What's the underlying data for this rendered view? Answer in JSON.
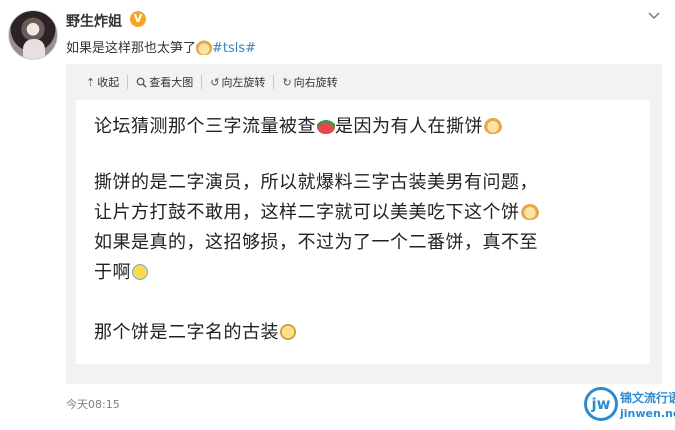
{
  "post": {
    "username": "野生炸姐",
    "verified_badge": "V",
    "text_prefix": "如果是这样那也太笋了",
    "hashtag": "#tsls#",
    "timestamp": "今天08:15"
  },
  "toolbar": {
    "collapse": "收起",
    "view_large": "查看大图",
    "rotate_left": "向左旋转",
    "rotate_right": "向右旋转"
  },
  "image_text": {
    "line1": "论坛猜测那个三字流量被查",
    "line1_tail": "是因为有人在撕饼",
    "line2": "撕饼的是二字演员，所以就爆料三字古装美男有问题，",
    "line3": "让片方打鼓不敢用，这样二字就可以美美吃下这个饼",
    "line4": "如果是真的，这招够损，不过为了一个二番饼，真不至",
    "line5": "于啊",
    "line6": "那个饼是二字名的古装"
  },
  "watermark": {
    "logo": "jw",
    "name": "锦文流行语",
    "url": "jinwen.net"
  },
  "icons": [
    "more-chevron-icon",
    "collapse-icon",
    "search-icon",
    "rotate-left-icon",
    "rotate-right-icon"
  ],
  "colors": {
    "link": "#3b83c4",
    "badge": "#f5a623",
    "toolbar_bg": "#f2f2f5",
    "watermark": "#2e8bd1"
  }
}
